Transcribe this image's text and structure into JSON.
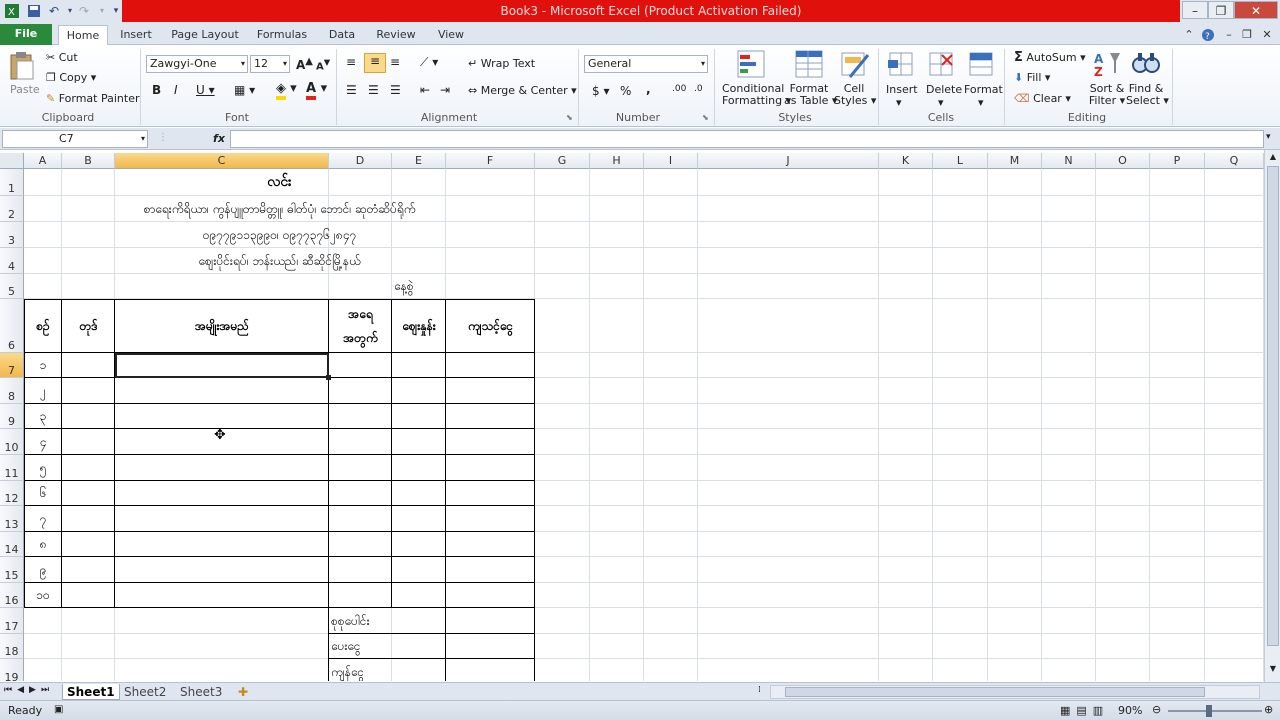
{
  "title": "Book3  -  Microsoft Excel (Product Activation Failed)",
  "tabs": [
    "File",
    "Home",
    "Insert",
    "Page Layout",
    "Formulas",
    "Data",
    "Review",
    "View"
  ],
  "clipboard": {
    "paste": "Paste",
    "cut": "Cut",
    "copy": "Copy",
    "format_painter": "Format Painter",
    "label": "Clipboard"
  },
  "font": {
    "name": "Zawgyi-One",
    "size": "12",
    "label": "Font"
  },
  "alignment": {
    "wrap_text": "Wrap Text",
    "merge_center": "Merge & Center",
    "label": "Alignment"
  },
  "number": {
    "format": "General",
    "label": "Number",
    "currency": "$",
    "percent": "%",
    "comma": ","
  },
  "styles": {
    "conditional": "Conditional",
    "conditional2": "Formatting",
    "format_table": "Format",
    "format_table2": "as Table",
    "cell_styles": "Cell",
    "cell_styles2": "Styles",
    "label": "Styles"
  },
  "cells": {
    "insert": "Insert",
    "delete": "Delete",
    "format": "Format",
    "label": "Cells"
  },
  "editing": {
    "autosum": "AutoSum",
    "fill": "Fill",
    "clear": "Clear",
    "sort": "Sort &",
    "sort2": "Filter",
    "find": "Find &",
    "find2": "Select",
    "label": "Editing"
  },
  "namebox": "C7",
  "fx": "fx",
  "columns": [
    "A",
    "B",
    "C",
    "D",
    "E",
    "F",
    "G",
    "H",
    "I",
    "J",
    "K",
    "L",
    "M",
    "N",
    "O",
    "P",
    "Q"
  ],
  "rows": [
    "1",
    "2",
    "3",
    "4",
    "5",
    "6",
    "7",
    "8",
    "9",
    "10",
    "11",
    "12",
    "13",
    "14",
    "15",
    "16",
    "17",
    "18",
    "19"
  ],
  "sheet": {
    "title": "လင်း",
    "line2": "စာရေးကိရိယာ၊ ကွန်ပျူတာမိတ္တူ၊ ဓါတ်ပုံ၊ ဘောင်၊ ဆုတံဆိပ်ရိုက်",
    "line3": "၀၉၇၇၉၁၁၃၉၉၀၊ ၀၉၇၇၃၇၆၂၈၄၇",
    "line4": "ဈေးပိုင်းရပ်၊ ဘန်းယည်၊ ဆီဆိုင်မြို့နယ်",
    "date_label": "နေ့စွဲ",
    "headers": {
      "no": "စဉ်",
      "code": "တုဒ်",
      "item": "အမျိုးအမည်",
      "qty1": "အရေ",
      "qty2": "အတွက်",
      "price": "ဈေးနှုန်း",
      "amount": "ကျသင့်ငွေ"
    },
    "numbers": [
      "၁",
      "၂",
      "၃",
      "၄",
      "၅",
      "၆",
      "၇",
      "၈",
      "၉",
      "၁၀"
    ],
    "total": "စုစုပေါင်း",
    "paid": "ပေးငွေ",
    "balance": "ကျန်ငွေ"
  },
  "sheet_tabs": [
    "Sheet1",
    "Sheet2",
    "Sheet3"
  ],
  "status": {
    "ready": "Ready",
    "zoom": "90%"
  },
  "colors": {
    "title_bar": "#e0100c",
    "file_tab": "#2a8a3b",
    "selected_header": "#f2b84b"
  }
}
